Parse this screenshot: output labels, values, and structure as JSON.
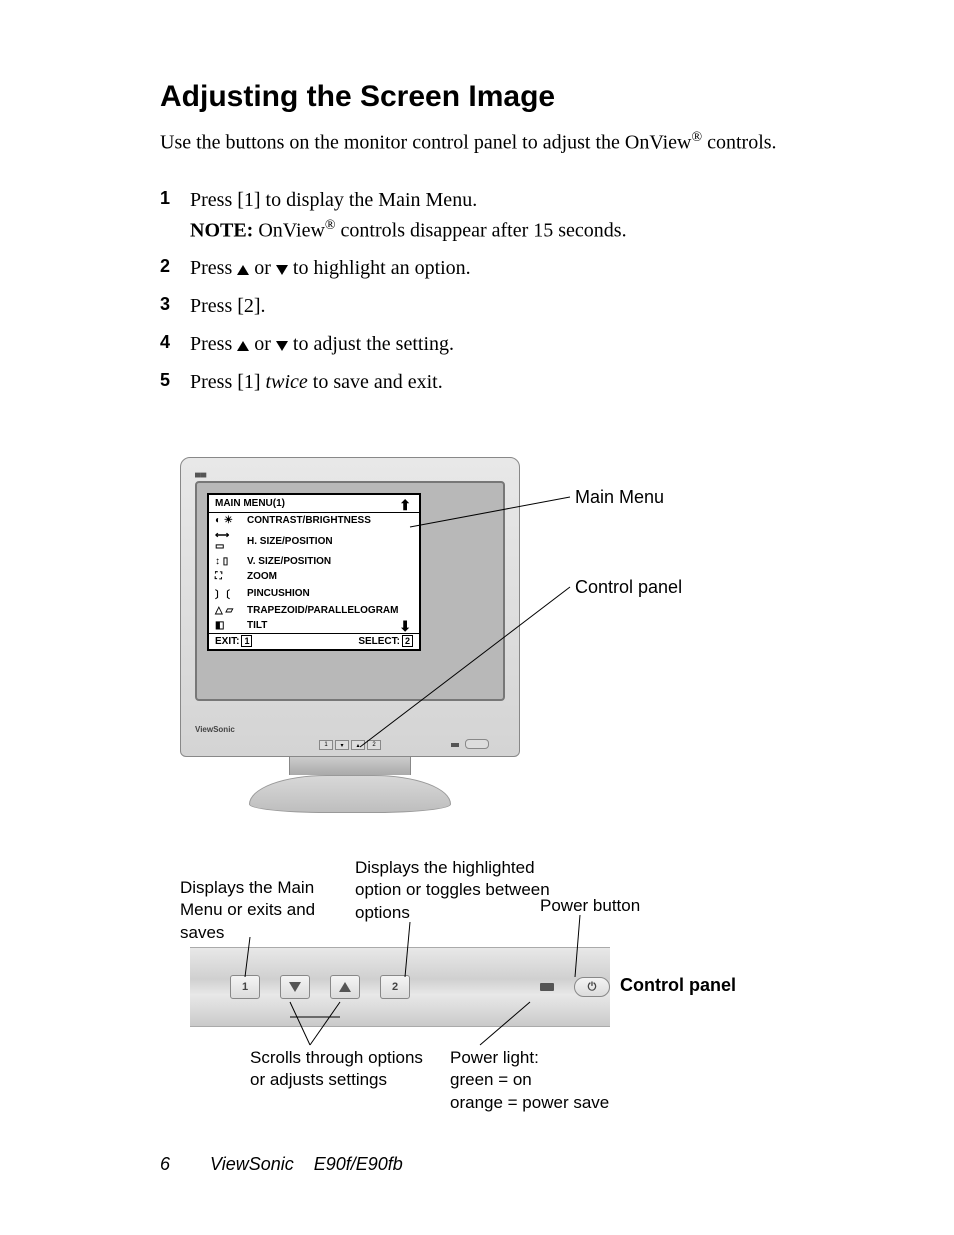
{
  "title": "Adjusting the Screen Image",
  "intro_a": "Use the buttons on the monitor control panel to adjust the OnView",
  "intro_b": " controls.",
  "reg": "®",
  "steps": {
    "s1a": "Press [1] to display the Main Menu.",
    "s1note_label": "NOTE:",
    "s1note_a": " OnView",
    "s1note_b": " controls disappear after 15 seconds.",
    "s2a": "Press ",
    "s2b": " or ",
    "s2c": " to highlight an option.",
    "s3": "Press [2].",
    "s4a": "Press ",
    "s4b": " or ",
    "s4c": " to adjust the setting.",
    "s5a": "Press [1] ",
    "s5i": "twice",
    "s5b": " to save and exit."
  },
  "osd": {
    "title": "MAIN MENU(1)",
    "rows": [
      "CONTRAST/BRIGHTNESS",
      "H. SIZE/POSITION",
      "V. SIZE/POSITION",
      "ZOOM",
      "PINCUSHION",
      "TRAPEZOID/PARALLELOGRAM",
      "TILT"
    ],
    "exit": "EXIT:",
    "select": "SELECT:",
    "key1": "1",
    "key2": "2"
  },
  "brand": "ViewSonic",
  "callouts": {
    "main_menu": "Main Menu",
    "control_panel": "Control panel",
    "display_main": "Displays the Main Menu or exits and saves",
    "display_opt": "Displays the highlighted option or toggles between options",
    "power_btn": "Power button",
    "scrolls": "Scrolls through options or adjusts settings",
    "power_light_a": "Power light:",
    "power_light_b": "green = on",
    "power_light_c": "orange = power save",
    "panel_bold": "Control panel"
  },
  "panel_keys": {
    "k1": "1",
    "k2": "2"
  },
  "footer": {
    "page": "6",
    "brand": "ViewSonic",
    "model": "E90f/E90fb"
  }
}
